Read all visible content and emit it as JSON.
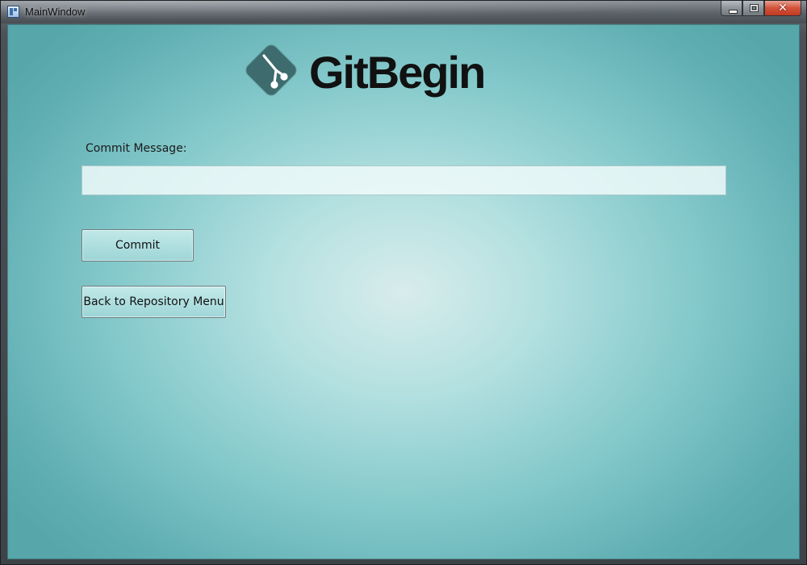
{
  "window": {
    "title": "MainWindow",
    "caption_buttons": {
      "minimize_icon": "minimize-icon",
      "maximize_icon": "maximize-icon",
      "close_icon": "close-icon",
      "close_glyph": "✕"
    }
  },
  "logo": {
    "icon": "git-branch-logo-icon",
    "text": "GitBegin"
  },
  "form": {
    "commit_label": "Commit Message:",
    "commit_value": "",
    "commit_placeholder": ""
  },
  "buttons": {
    "commit_label": "Commit",
    "back_label": "Back to Repository Menu"
  },
  "colors": {
    "background_center": "#d8ecec",
    "background_edge": "#56a6aa",
    "logo_mark": "#3d6b6e",
    "close_button": "#d2523a"
  }
}
